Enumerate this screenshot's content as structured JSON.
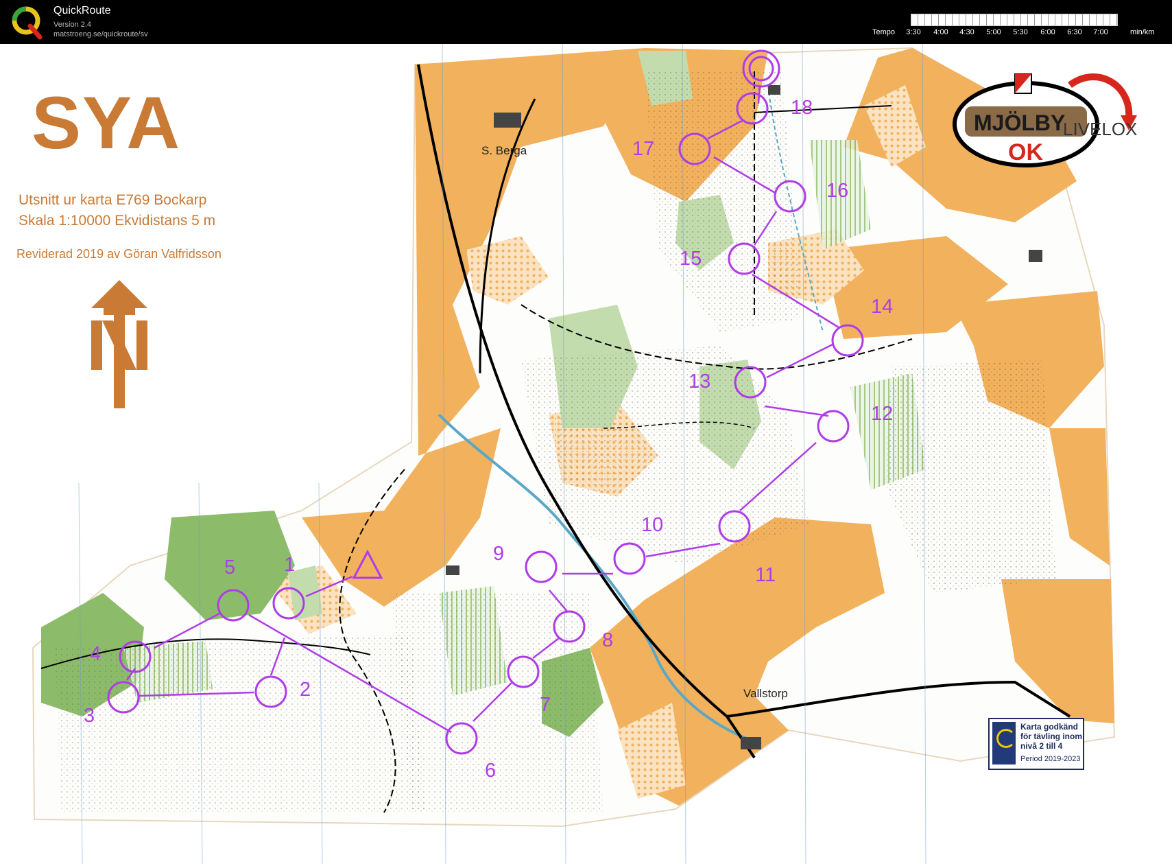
{
  "app": {
    "name": "QuickRoute",
    "version": "Version 2.4",
    "url": "matstroeng.se/quickroute/sv"
  },
  "tempo": {
    "label": "Tempo",
    "ticks": [
      "3:30",
      "4:00",
      "4:30",
      "5:00",
      "5:30",
      "6:00",
      "6:30",
      "7:00"
    ],
    "unit": "min/km"
  },
  "map": {
    "title": "SYA",
    "subtitle_line1": "Utsnitt ur karta E769 Bockarp",
    "subtitle_line2": "Skala 1:10000  Ekvidistans 5 m",
    "revision": "Reviderad 2019 av Göran Valfridsson",
    "places": [
      "S. Berga",
      "Vallstorp"
    ],
    "club_logo_text": [
      "MJÖLBY",
      "OK"
    ],
    "livelox_text": "LIVELOX",
    "approval": [
      "Karta godkänd",
      "för tävling inom",
      "nivå 2 till 4",
      "Period 2019-2023"
    ],
    "course_color": "#b03ce8",
    "forest_color": "#f2b15c",
    "green_color": "#8cbc6a",
    "control_numbers": [
      "1",
      "2",
      "3",
      "4",
      "5",
      "6",
      "7",
      "8",
      "9",
      "10",
      "11",
      "12",
      "13",
      "14",
      "15",
      "16",
      "17",
      "18"
    ]
  }
}
